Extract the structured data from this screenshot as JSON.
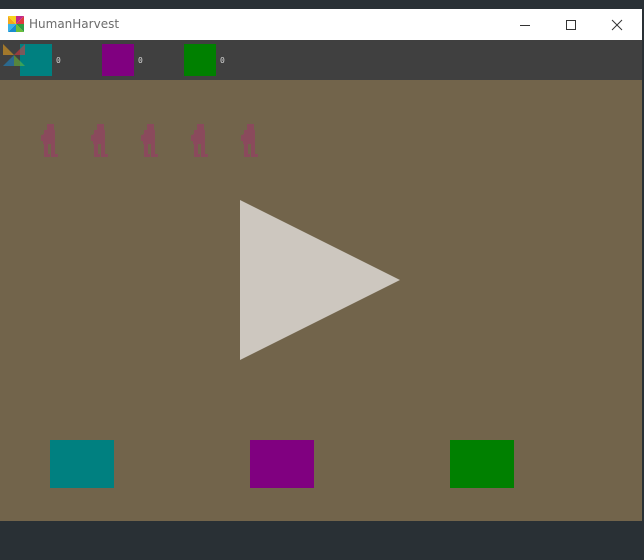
{
  "window": {
    "title": "HumanHarvest"
  },
  "hud": {
    "items": [
      {
        "color": "#008080",
        "count": "0"
      },
      {
        "color": "#800080",
        "count": "0"
      },
      {
        "color": "#008000",
        "count": "0"
      }
    ]
  },
  "playfield": {
    "background": "#72644b",
    "human_count": 5,
    "human_color": "#8a4a5c",
    "play_button_color": "#cdc7bf",
    "pads": [
      {
        "color": "#008080"
      },
      {
        "color": "#800080"
      },
      {
        "color": "#008000"
      }
    ]
  }
}
